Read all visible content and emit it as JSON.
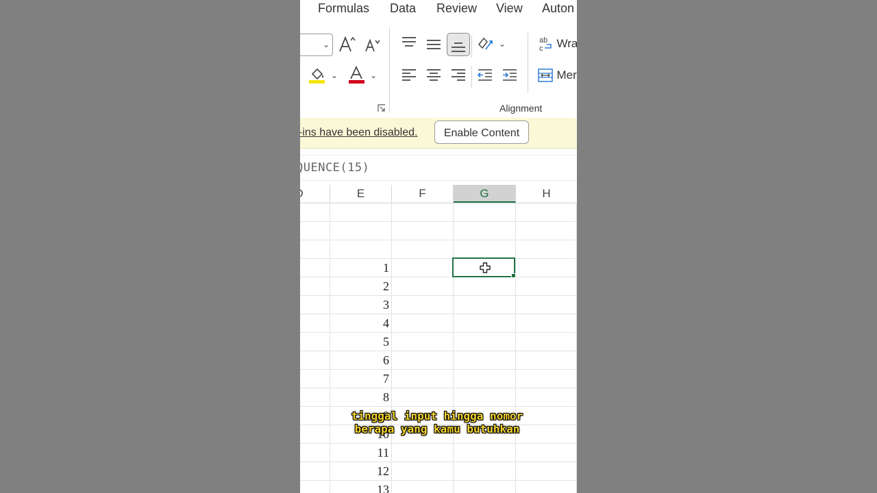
{
  "menu_tabs": [
    "Formulas",
    "Data",
    "Review",
    "View",
    "Auton"
  ],
  "ribbon": {
    "wrap_text_label": "Wra",
    "merge_label": "Mer",
    "wrap_icon_glyph": "ab",
    "alignment_group_label": "Alignment",
    "highlight_color": "#f5e50a",
    "font_color": "#d0021b"
  },
  "message_bar": {
    "text": "-ins have been disabled.",
    "button_label": "Enable Content"
  },
  "formula_bar": {
    "formula": "QUENCE(15)"
  },
  "grid": {
    "columns": [
      "D",
      "E",
      "F",
      "G",
      "H"
    ],
    "selected_column": "G",
    "values": [
      "1",
      "2",
      "3",
      "4",
      "5",
      "6",
      "7",
      "8",
      "9",
      "10",
      "11",
      "12",
      "13"
    ],
    "accent_color": "#217346"
  },
  "subtitle": {
    "line1": "tinggal input hingga nomor",
    "line2": "berapa yang kamu butuhkan"
  }
}
